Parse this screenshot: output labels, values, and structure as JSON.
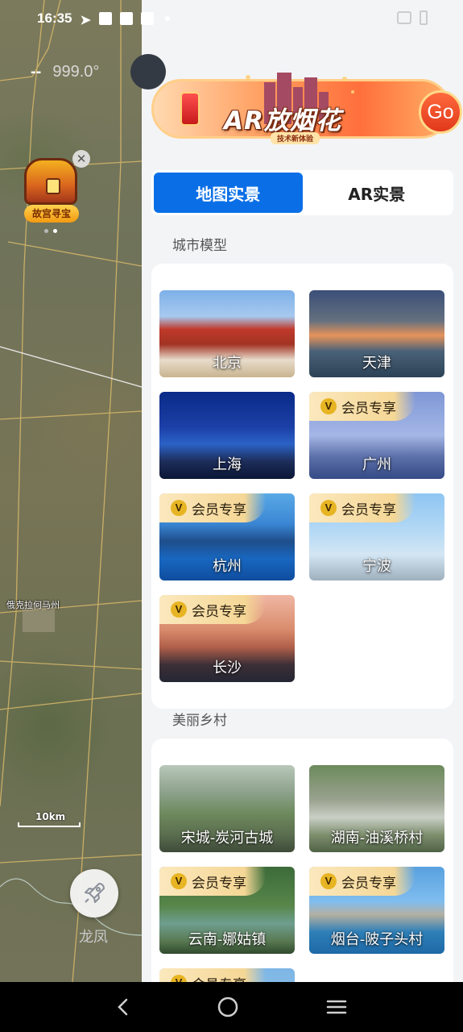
{
  "status_bar": {
    "time": "16:35"
  },
  "map": {
    "heading_dashes": "--",
    "heading_degrees": "999.0°",
    "treasure_label": "故宫寻宝",
    "place_label": "俄克拉何马州",
    "scale_label": "10km",
    "bottom_label": "龙凤"
  },
  "banner": {
    "title": "AR放烟花",
    "subtitle": "技术新体验",
    "go_label": "Go"
  },
  "tabs": [
    {
      "label": "地图实景",
      "active": true
    },
    {
      "label": "AR实景",
      "active": false
    }
  ],
  "vip_label": "会员专享",
  "sections": [
    {
      "title": "城市模型",
      "items": [
        {
          "name": "北京",
          "vip": false
        },
        {
          "name": "天津",
          "vip": false
        },
        {
          "name": "上海",
          "vip": false
        },
        {
          "name": "广州",
          "vip": true
        },
        {
          "name": "杭州",
          "vip": true
        },
        {
          "name": "宁波",
          "vip": true
        },
        {
          "name": "长沙",
          "vip": true
        }
      ]
    },
    {
      "title": "美丽乡村",
      "items": [
        {
          "name": "宋城-炭河古城",
          "vip": false
        },
        {
          "name": "湖南-油溪桥村",
          "vip": false
        },
        {
          "name": "云南-娜姑镇",
          "vip": true
        },
        {
          "name": "烟台-陂子头村",
          "vip": true
        }
      ]
    }
  ]
}
